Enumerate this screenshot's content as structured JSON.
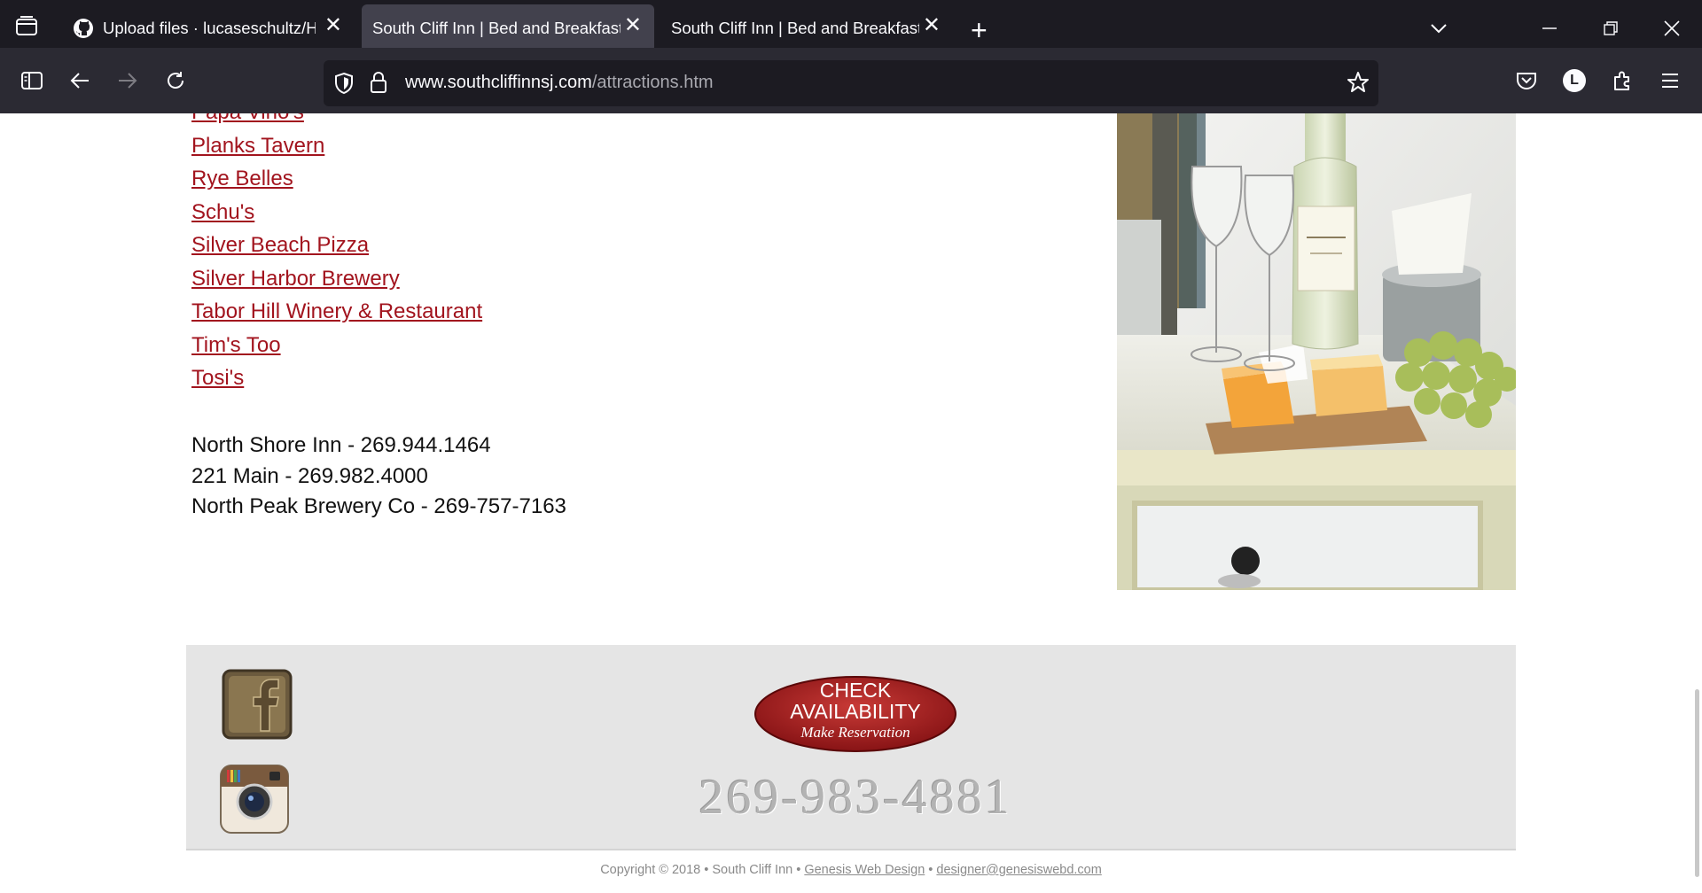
{
  "browser": {
    "tabs": [
      {
        "label": "Upload files · lucaseschultz/HTT",
        "icon": "github-icon",
        "active": false
      },
      {
        "label": "South Cliff Inn | Bed and Breakfast |",
        "active": true
      },
      {
        "label": "South Cliff Inn | Bed and Breakfast |",
        "active": false
      }
    ],
    "url_domain": "www.southcliffinnsj.com",
    "url_path": "/attractions.htm",
    "account_initial": "L"
  },
  "page": {
    "partial_link": "Papa Vino's",
    "restaurant_links": [
      "Planks Tavern",
      "Rye Belles",
      "Schu's",
      "Silver Beach Pizza",
      "Silver Harbor Brewery",
      "Tabor Hill Winery & Restaurant",
      "Tim's Too",
      "Tosi's"
    ],
    "contacts": [
      "North Shore Inn - 269.944.1464",
      "221 Main - 269.982.4000",
      "North Peak Brewery Co - 269-757-7163"
    ],
    "footer": {
      "check_availability_line1": "CHECK",
      "check_availability_line2": "AVAILABILITY",
      "check_availability_line3": "Make Reservation",
      "phone": "269-983-4881",
      "copyright_prefix": "Copyright © 2018 • South Cliff Inn •",
      "designer_link": "Genesis Web Design",
      "separator": "•",
      "email_link": "designer@genesiswebd.com"
    }
  },
  "colors": {
    "link": "#a2141e",
    "chrome_dark": "#1c1b22",
    "chrome_toolbar": "#2b2a33",
    "footer_bg": "#e5e5e5",
    "button_red": "#8e1216"
  }
}
